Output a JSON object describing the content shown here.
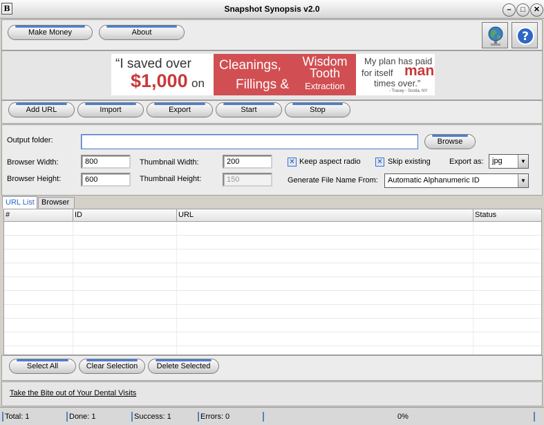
{
  "window": {
    "title": "Snapshot Synopsis v2.0",
    "app_icon": "B",
    "minimize": "–",
    "maximize": "□",
    "close": "✕"
  },
  "toolbar_top": {
    "make_money": "Make Money",
    "about": "About",
    "globe_icon": "globe-icon",
    "help_icon": "help-icon"
  },
  "ad_banner": {
    "quote_line1": "“I saved over",
    "amount": "$1,000",
    "on": "on",
    "service1": "Cleanings,",
    "service2": "Fillings &",
    "service3": "Wisdom Tooth",
    "service4": "Extraction",
    "tag1": "My plan has paid",
    "tag2": "for itself",
    "tag_many": "many",
    "tag3": "times over.”",
    "attribution": "- Tracey - Scotia, NY",
    "accent_color": "#d9534f"
  },
  "actions": {
    "add_url": "Add URL",
    "import": "Import",
    "export": "Export",
    "start": "Start",
    "stop": "Stop"
  },
  "settings": {
    "output_folder_label": "Output folder:",
    "output_folder_value": "",
    "browse": "Browse",
    "browser_width_label": "Browser Width:",
    "browser_width": "800",
    "browser_height_label": "Browser Height:",
    "browser_height": "600",
    "thumb_width_label": "Thumbnail Width:",
    "thumb_width": "200",
    "thumb_height_label": "Thumbnail Height:",
    "thumb_height": "150",
    "keep_aspect": "Keep aspect radio",
    "skip_existing": "Skip existing",
    "export_as_label": "Export as:",
    "export_as": "jpg",
    "generate_label": "Generate File Name From:",
    "generate_value": "Automatic Alphanumeric ID"
  },
  "tabs": {
    "url_list": "URL List",
    "browser": "Browser"
  },
  "table": {
    "columns": [
      "#",
      "ID",
      "URL",
      "Status"
    ],
    "rows": []
  },
  "selection": {
    "select_all": "Select All",
    "clear": "Clear Selection",
    "delete": "Delete Selected"
  },
  "footer_link": "Take the Bite out of Your Dental Visits",
  "status": {
    "total": "Total: 1",
    "done": "Done: 1",
    "success": "Success: 1",
    "errors": "Errors: 0",
    "progress": "0%"
  }
}
